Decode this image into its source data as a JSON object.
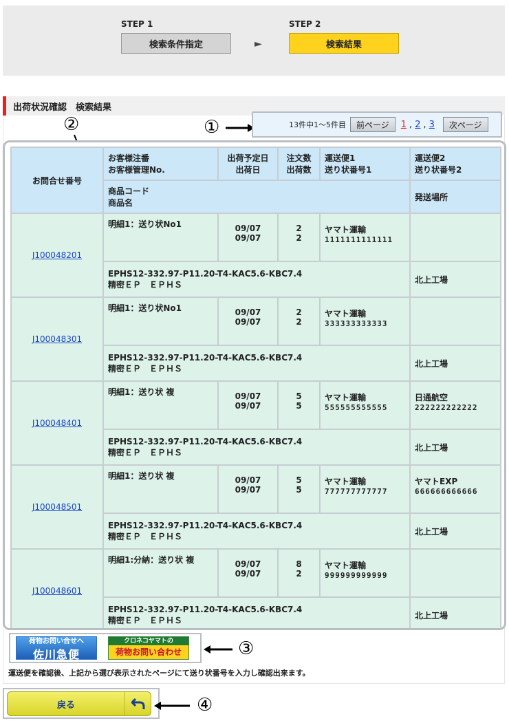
{
  "steps": {
    "step1_label": "STEP 1",
    "step1_button": "検索条件指定",
    "arrow": "►",
    "step2_label": "STEP 2",
    "step2_button": "検索結果"
  },
  "section_title": "出荷状況確認　検索結果",
  "pager": {
    "count_text": "13件中1〜5件目",
    "prev_label": "前ページ",
    "pages": [
      "1",
      "2",
      "3"
    ],
    "next_label": "次ページ"
  },
  "callouts": [
    "①",
    "②",
    "③",
    "④"
  ],
  "table": {
    "header": {
      "inquiry_no": "お問合せ番号",
      "order_line1": "お客様注番",
      "order_line2": "お客様管理No.",
      "ship_line1": "出荷予定日",
      "ship_line2": "出荷日",
      "qty_line1": "注文数",
      "qty_line2": "出荷数",
      "carrier1_line1": "運送便1",
      "carrier1_line2": "送り状番号1",
      "carrier2_line1": "運送便2",
      "carrier2_line2": "送り状番号2",
      "product_line1": "商品コード",
      "product_line2": "商品名",
      "ship_from": "発送場所"
    },
    "rows": [
      {
        "inquiry": "J100048201",
        "detail": "明細1：送り状No1",
        "date1": "09/07",
        "date2": "09/07",
        "qty1": "2",
        "qty2": "2",
        "carrier1": "ヤマト運輸",
        "tracking1": "1111111111111",
        "carrier2": "",
        "tracking2": "",
        "product_code": "EPHS12-332.97-P11.20-T4-KAC5.6-KBC7.4",
        "product_name": "精密ＥＰ　ＥＰＨＳ",
        "ship_from": "北上工場"
      },
      {
        "inquiry": "J100048301",
        "detail": "明細1：送り状No1",
        "date1": "09/07",
        "date2": "09/07",
        "qty1": "2",
        "qty2": "2",
        "carrier1": "ヤマト運輸",
        "tracking1": "333333333333",
        "carrier2": "",
        "tracking2": "",
        "product_code": "EPHS12-332.97-P11.20-T4-KAC5.6-KBC7.4",
        "product_name": "精密ＥＰ　ＥＰＨＳ",
        "ship_from": "北上工場"
      },
      {
        "inquiry": "J100048401",
        "detail": "明細1：送り状 複",
        "date1": "09/07",
        "date2": "09/07",
        "qty1": "5",
        "qty2": "5",
        "carrier1": "ヤマト運輸",
        "tracking1": "555555555555",
        "carrier2": "日通航空",
        "tracking2": "222222222222",
        "product_code": "EPHS12-332.97-P11.20-T4-KAC5.6-KBC7.4",
        "product_name": "精密ＥＰ　ＥＰＨＳ",
        "ship_from": "北上工場"
      },
      {
        "inquiry": "J100048501",
        "detail": "明細1：送り状 複",
        "date1": "09/07",
        "date2": "09/07",
        "qty1": "5",
        "qty2": "5",
        "carrier1": "ヤマト運輸",
        "tracking1": "777777777777",
        "carrier2": "ヤマトEXP",
        "tracking2": "666666666666",
        "product_code": "EPHS12-332.97-P11.20-T4-KAC5.6-KBC7.4",
        "product_name": "精密ＥＰ　ＥＰＨＳ",
        "ship_from": "北上工場"
      },
      {
        "inquiry": "J100048601",
        "detail": "明細1:分納：送り状 複",
        "date1": "09/07",
        "date2": "09/07",
        "qty1": "8",
        "qty2": "2",
        "carrier1": "ヤマト運輸",
        "tracking1": "999999999999",
        "carrier2": "",
        "tracking2": "",
        "product_code": "EPHS12-332.97-P11.20-T4-KAC5.6-KBC7.4",
        "product_name": "精密ＥＰ　ＥＰＨＳ",
        "ship_from": "北上工場"
      }
    ]
  },
  "banners": {
    "sagawa_top": "荷物お問い合せへ",
    "sagawa_main": "佐川急便",
    "yamato_top": "クロネコヤマトの",
    "yamato_main": "荷物お問い合わせ"
  },
  "note": "運送便を確認後、上記から選び表示されたページにて送り状番号を入力し確認出来ます。",
  "back_label": "戻る",
  "colors": {
    "accent_red": "#e8221c",
    "step_active": "#ffd21e",
    "header_bg": "#cbe7f8",
    "row_bg": "#ddf3ea",
    "link": "#1a44c8"
  }
}
